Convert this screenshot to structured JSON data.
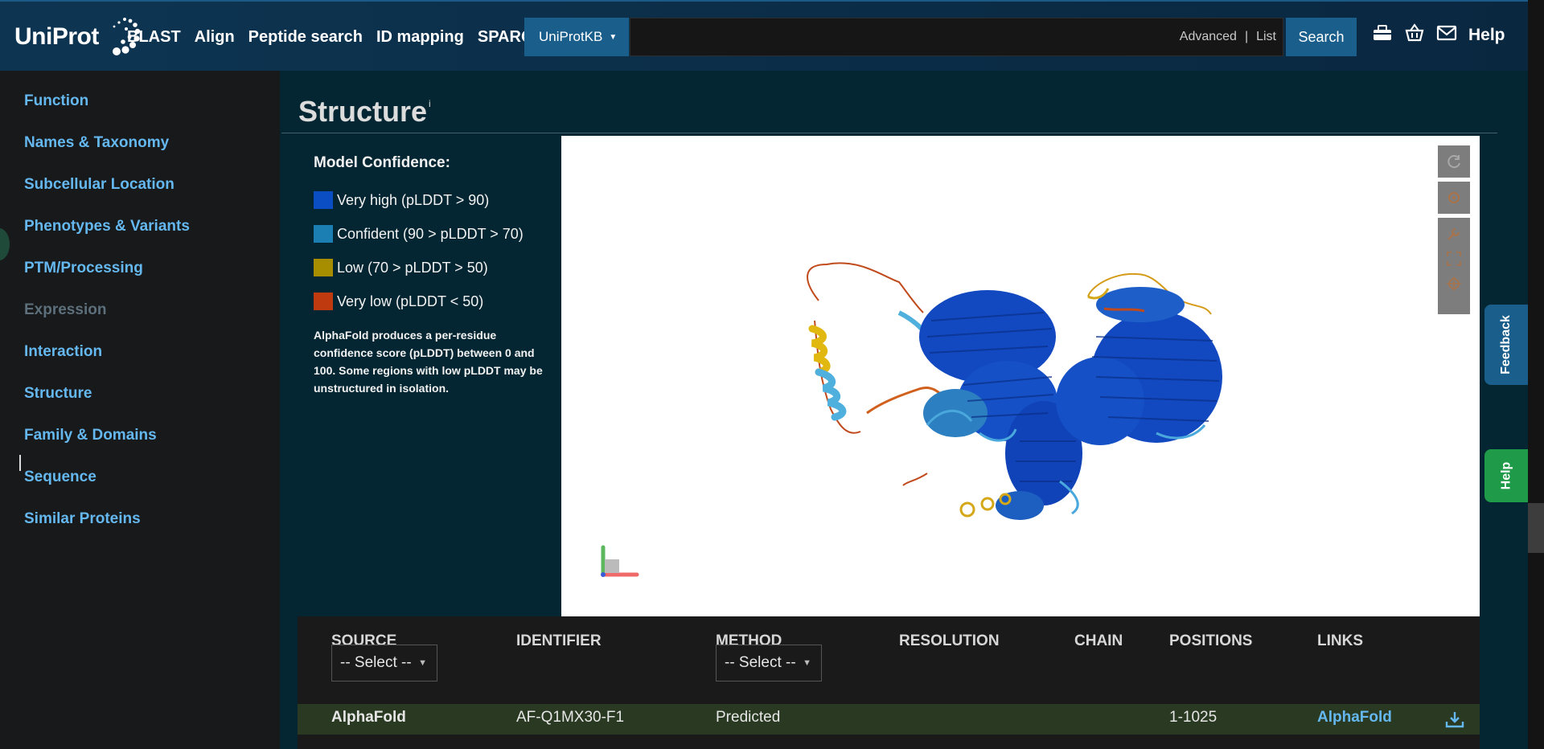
{
  "header": {
    "logo_text": "UniProt",
    "nav": [
      "BLAST",
      "Align",
      "Peptide search",
      "ID mapping",
      "SPARQL"
    ],
    "database_selector": "UniProtKB",
    "search_value": "",
    "search_placeholder": "",
    "advanced_label": "Advanced",
    "list_label": "List",
    "search_button": "Search",
    "help_label": "Help"
  },
  "sidebar": {
    "items": [
      {
        "label": "Function"
      },
      {
        "label": "Names & Taxonomy"
      },
      {
        "label": "Subcellular Location"
      },
      {
        "label": "Phenotypes & Variants"
      },
      {
        "label": "PTM/Processing"
      },
      {
        "label": "Expression"
      },
      {
        "label": "Interaction"
      },
      {
        "label": "Structure"
      },
      {
        "label": "Family & Domains"
      },
      {
        "label": "Sequence"
      },
      {
        "label": "Similar Proteins"
      }
    ]
  },
  "structure": {
    "title": "Structure",
    "info_marker": "i",
    "legend": {
      "title": "Model Confidence:",
      "entries": [
        {
          "label": "Very high (pLDDT > 90)",
          "color": "#0b4ec3"
        },
        {
          "label": "Confident (90 > pLDDT > 70)",
          "color": "#1b7fb3"
        },
        {
          "label": "Low (70 > pLDDT > 50)",
          "color": "#a78d00"
        },
        {
          "label": "Very low (pLDDT < 50)",
          "color": "#c03a10"
        }
      ],
      "note": "AlphaFold produces a per-residue confidence score (pLDDT) between 0 and 100. Some regions with low pLDDT may be unstructured in isolation."
    }
  },
  "table": {
    "headers": [
      "SOURCE",
      "IDENTIFIER",
      "METHOD",
      "RESOLUTION",
      "CHAIN",
      "POSITIONS",
      "LINKS"
    ],
    "source_filter": "-- Select --",
    "method_filter": "-- Select --",
    "rows": [
      {
        "source": "AlphaFold",
        "identifier": "AF-Q1MX30-F1",
        "method": "Predicted",
        "resolution": "",
        "chain": "",
        "positions": "1-1025",
        "links": "AlphaFold"
      }
    ]
  },
  "side_tabs": {
    "feedback": "Feedback",
    "help": "Help"
  },
  "colors": {
    "accent": "#1a5e8c",
    "link": "#65b8ef",
    "help_green": "#1f9a48"
  }
}
